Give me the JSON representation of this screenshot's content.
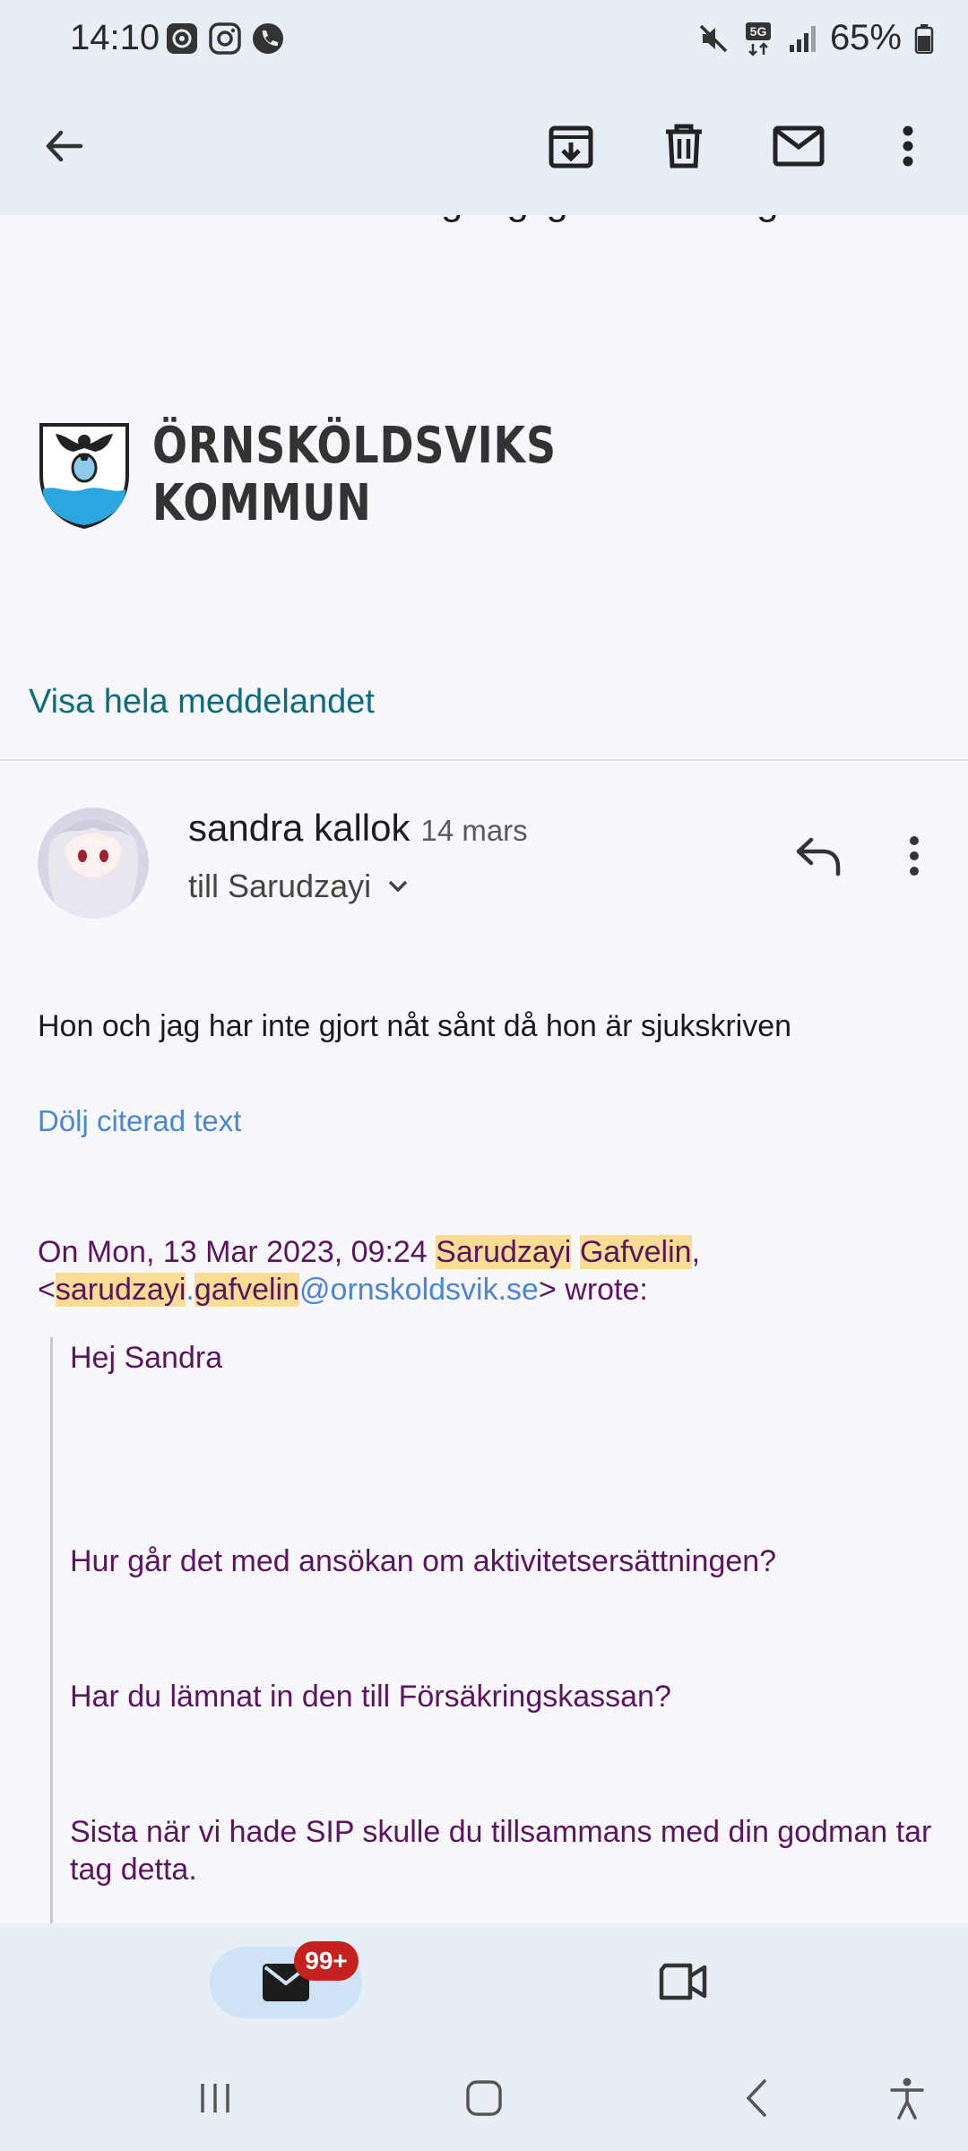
{
  "status_bar": {
    "time": "14:10",
    "left_icons": [
      "screen-recorder-icon",
      "instagram-icon",
      "phone-call-icon"
    ],
    "right_icons": [
      "mute-icon",
      "5g-icon",
      "signal-icon",
      "battery-icon"
    ],
    "battery": "65%"
  },
  "toolbar": {
    "icons": [
      "back-arrow-icon",
      "archive-icon",
      "delete-icon",
      "mark-unread-icon",
      "more-vert-icon"
    ]
  },
  "email": {
    "cut_off_line": "Ha ditt kundnummer tillgängligt när du ringer oss.",
    "logo_line1": "ÖRNSKÖLDSVIKS",
    "logo_line2": "KOMMUN",
    "show_full_message": "Visa hela meddelandet",
    "sender": "sandra kallok",
    "date": "14 mars",
    "to": "till Sarudzayi",
    "body": "Hon och jag har inte gjort nåt sånt då hon är sjukskriven",
    "hide_quoted": "Dölj citerad text",
    "quote_header": {
      "prefix": "On Mon, 13 Mar 2023, 09:24 ",
      "name_first": "Sarudzayi",
      "name_last": "Gafvelin",
      "comma": ",",
      "lt": "<",
      "email_user_first": "sarudzayi",
      "dot": ".",
      "email_user_last": "gafvelin",
      "email_domain": "@ornskoldsvik.se",
      "suffix": "> wrote:"
    },
    "quote_lines": [
      "Hej Sandra",
      "Hur går det med ansökan om aktivitetsersättningen?",
      "Har du lämnat in den till Försäkringskassan?",
      "Sista när vi hade SIP skulle du tillsammans med din godman tar tag  detta."
    ]
  },
  "bottom_nav": {
    "mail_badge": "99+",
    "items": [
      "mail-icon",
      "meet-video-icon"
    ]
  },
  "system_nav": [
    "recent-apps-icon",
    "home-icon",
    "back-icon",
    "accessibility-icon"
  ],
  "colors": {
    "bar_bg": "#e8eef6",
    "quote_text": "#5a1460",
    "link": "#4a86d4",
    "highlight": "#f9dd94",
    "badge": "#c5221f"
  }
}
